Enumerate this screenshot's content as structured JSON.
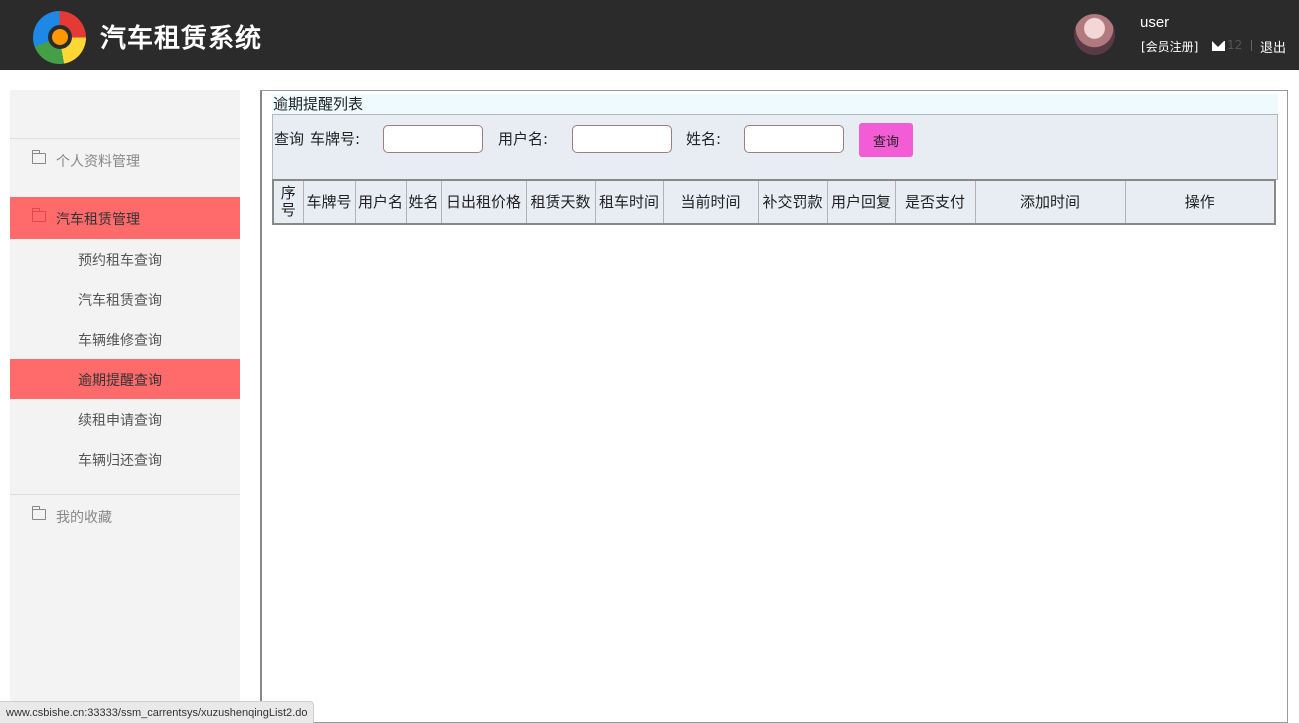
{
  "header": {
    "app_title": "汽车租赁系统",
    "username": "user",
    "register_label": "[会员注册]",
    "mail_count": "12",
    "logout_label": "退出"
  },
  "sidebar": {
    "groups": [
      {
        "label": "个人资料管理",
        "icon": "folder-icon"
      },
      {
        "label": "汽车租赁管理",
        "icon": "folder-icon",
        "active": true
      },
      {
        "label": "我的收藏",
        "icon": "folder-icon"
      }
    ],
    "items": [
      {
        "label": "预约租车查询"
      },
      {
        "label": "汽车租赁查询"
      },
      {
        "label": "车辆维修查询"
      },
      {
        "label": "逾期提醒查询",
        "active": true
      },
      {
        "label": "续租申请查询"
      },
      {
        "label": "车辆归还查询"
      }
    ]
  },
  "main": {
    "panel_title": "逾期提醒列表",
    "search": {
      "query_prefix": "查询",
      "plate_label": "车牌号:",
      "plate_value": "",
      "user_label": "用户名:",
      "user_value": "",
      "name_label": "姓名:",
      "name_value": "",
      "button_label": "查询"
    },
    "table": {
      "columns": [
        "序号",
        "车牌号",
        "用户名",
        "姓名",
        "日出租价格",
        "租赁天数",
        "租车时间",
        "当前时间",
        "补交罚款",
        "用户回复",
        "是否支付",
        "添加时间",
        "操作"
      ],
      "rows": []
    }
  },
  "status_bar": {
    "url": "www.csbishe.cn:33333/ssm_carrentsys/xuzushenqingList2.do"
  },
  "colors": {
    "header_bg": "#2b2b2b",
    "sidebar_bg": "#f3f3f3",
    "active_bg": "#ff6b6b",
    "query_button": "#f25cd4",
    "table_header_bg": "#e8edf3"
  }
}
